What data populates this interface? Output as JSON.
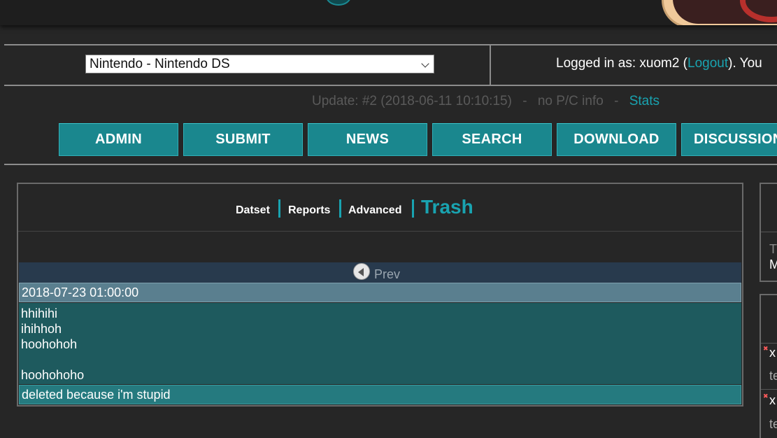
{
  "header": {
    "system_select": "Nintendo - Nintendo DS",
    "login_prefix": "Logged in as: xuom2 (",
    "logout_label": "Logout",
    "login_suffix": ").  You"
  },
  "update": {
    "text": "Update: #2 (2018-06-11 10:10:15)",
    "pc_info": "no P/C info",
    "sep": "-",
    "stats_label": "Stats"
  },
  "nav": {
    "items": [
      "ADMIN",
      "SUBMIT",
      "NEWS",
      "SEARCH",
      "DOWNLOAD",
      "DISCUSSION"
    ]
  },
  "tabs": {
    "datset": "Datset",
    "reports": "Reports",
    "advanced": "Advanced",
    "trash": "Trash"
  },
  "pager": {
    "prev_label": "Prev"
  },
  "entry": {
    "date": "2018-07-23 01:00:00",
    "body": "hhihihi\nihihhoh\nhoohohoh\n\nhoohohoho",
    "reason": "deleted because i'm stupid"
  },
  "right_panels": {
    "p1_line1": "T",
    "p1_line2": "M",
    "p2_line1": "x",
    "p2_line2": "te",
    "p2_line3": "x",
    "p2_line4": "te"
  },
  "colors": {
    "accent": "#19a3b0",
    "nav_button": "#1a878e",
    "background": "#262626"
  }
}
